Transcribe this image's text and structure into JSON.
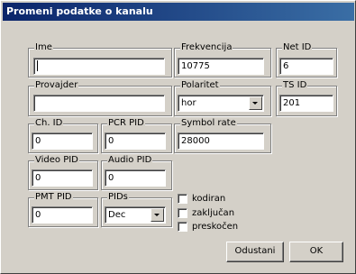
{
  "window": {
    "title": "Promeni podatke o kanalu"
  },
  "fields": {
    "ime": {
      "label": "Ime",
      "value": ""
    },
    "frekvencija": {
      "label": "Frekvencija",
      "value": "10775"
    },
    "net_id": {
      "label": "Net ID",
      "value": "6"
    },
    "provajder": {
      "label": "Provajder",
      "value": ""
    },
    "polaritet": {
      "label": "Polaritet",
      "value": "hor"
    },
    "ts_id": {
      "label": "TS ID",
      "value": "201"
    },
    "ch_id": {
      "label": "Ch. ID",
      "value": "0"
    },
    "pcr_pid": {
      "label": "PCR PID",
      "value": "0"
    },
    "symbol_rate": {
      "label": "Symbol rate",
      "value": "28000"
    },
    "video_pid": {
      "label": "Video PID",
      "value": "0"
    },
    "audio_pid": {
      "label": "Audio PID",
      "value": "0"
    },
    "pmt_pid": {
      "label": "PMT PID",
      "value": "0"
    },
    "pids": {
      "label": "PIDs",
      "value": "Dec"
    }
  },
  "checkboxes": [
    {
      "label": "kodiran",
      "checked": false
    },
    {
      "label": "zaključan",
      "checked": false
    },
    {
      "label": "preskočen",
      "checked": false
    }
  ],
  "buttons": {
    "cancel": "Odustani",
    "ok": "OK"
  }
}
